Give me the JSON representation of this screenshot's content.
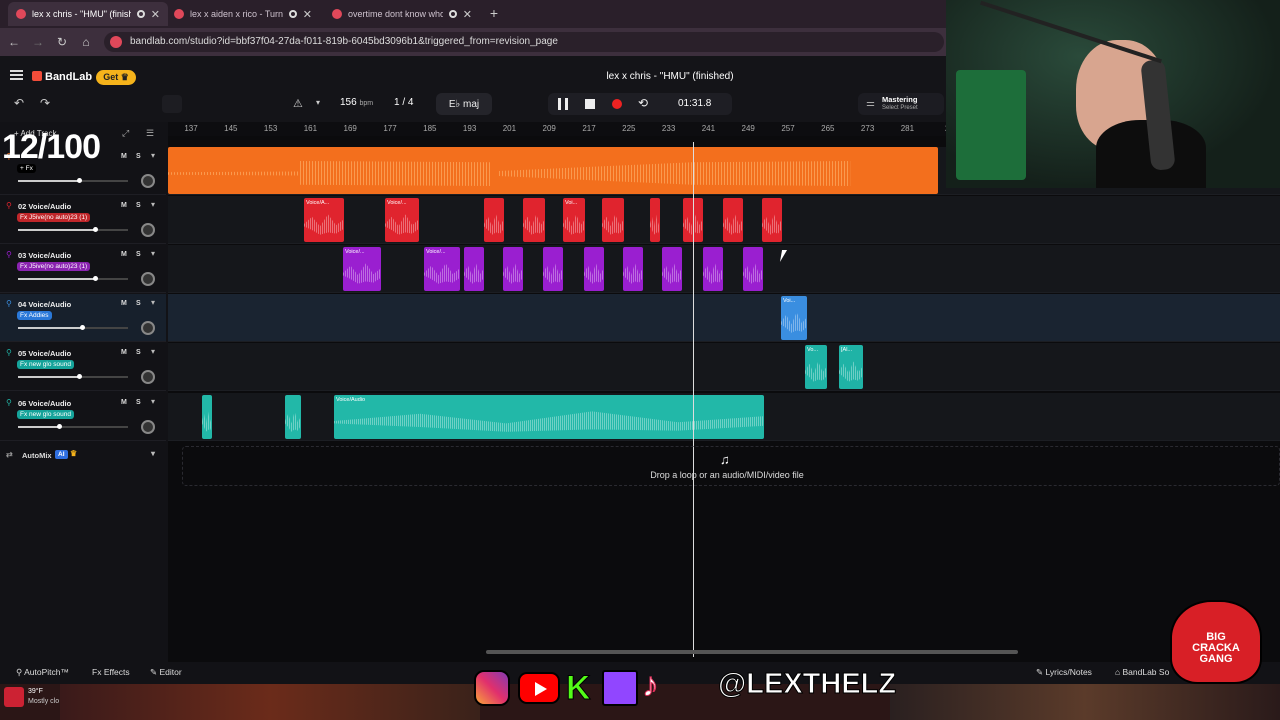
{
  "browser": {
    "tabs": [
      {
        "title": "lex x chris - \"HMU\" (finishe"
      },
      {
        "title": "lex x aiden x rico - Turn U U"
      },
      {
        "title": "overtime dont know who to"
      }
    ],
    "url": "bandlab.com/studio?id=bbf37f04-27da-f011-819b-6045bd3096b1&triggered_from=revision_page"
  },
  "app": {
    "logo": "BandLab",
    "get_label": "Get",
    "project_title": "lex x chris - \"HMU\" (finished)",
    "tempo": "156",
    "tempo_unit": "bpm",
    "time_sig": "1 / 4",
    "key": "E♭ maj",
    "time": "01:31.8",
    "mastering": "Mastering",
    "preset": "Select Preset",
    "add_track": "Add Track"
  },
  "ruler": [
    "137",
    "145",
    "153",
    "161",
    "169",
    "177",
    "185",
    "193",
    "201",
    "209",
    "217",
    "225",
    "233",
    "241",
    "249",
    "257",
    "265",
    "273",
    "281",
    "2"
  ],
  "tracks": [
    {
      "name": "",
      "fx": "+ Fx",
      "fxcolor": "#000000",
      "color": "#f36f1d",
      "volume": 0.55
    },
    {
      "name": "02 Voice/Audio",
      "fx": "Fx J5ive(no auto)23 (1)",
      "fxcolor": "#c0262a",
      "color": "#e0242e",
      "volume": 0.7
    },
    {
      "name": "03 Voice/Audio",
      "fx": "Fx J5ive(no auto)23 (1)",
      "fxcolor": "#8a23b0",
      "color": "#9a1fd0",
      "volume": 0.7
    },
    {
      "name": "04 Voice/Audio",
      "fx": "Fx Addies",
      "fxcolor": "#2a78d8",
      "color": "#3a8ee0",
      "volume": 0.58
    },
    {
      "name": "05 Voice/Audio",
      "fx": "Fx new glo sound",
      "fxcolor": "#15a39a",
      "color": "#1fb3a6",
      "volume": 0.55
    },
    {
      "name": "06 Voice/Audio",
      "fx": "Fx new glo sound",
      "fxcolor": "#15a39a",
      "color": "#22b8a8",
      "volume": 0.37
    }
  ],
  "clip_labels": {
    "t2": [
      "Voice/A...",
      "Voice/...",
      "Voi..."
    ],
    "t3": [
      "Voice/...",
      "Voice/..."
    ],
    "t4": [
      "Voi..."
    ],
    "t5": [
      "Vo...",
      "[Al..."
    ],
    "t6": [
      "Voice/Audio"
    ]
  },
  "automix": "AutoMix",
  "ai_badge": "AI",
  "drop_text": "Drop a loop or an audio/MIDI/video file",
  "bottom": {
    "autopitch": "AutoPitch™",
    "effects": "Effects",
    "editor": "Editor",
    "lyrics": "Lyrics/Notes",
    "sounds": "BandLab So"
  },
  "overlay": {
    "counter": "12/100",
    "handle": "@LEXTHELZ",
    "badge_lines": [
      "BIG",
      "CRACKA",
      "GANG"
    ]
  },
  "taskbar": {
    "weather": "39°F",
    "weather_sub": "Mostly clo"
  }
}
